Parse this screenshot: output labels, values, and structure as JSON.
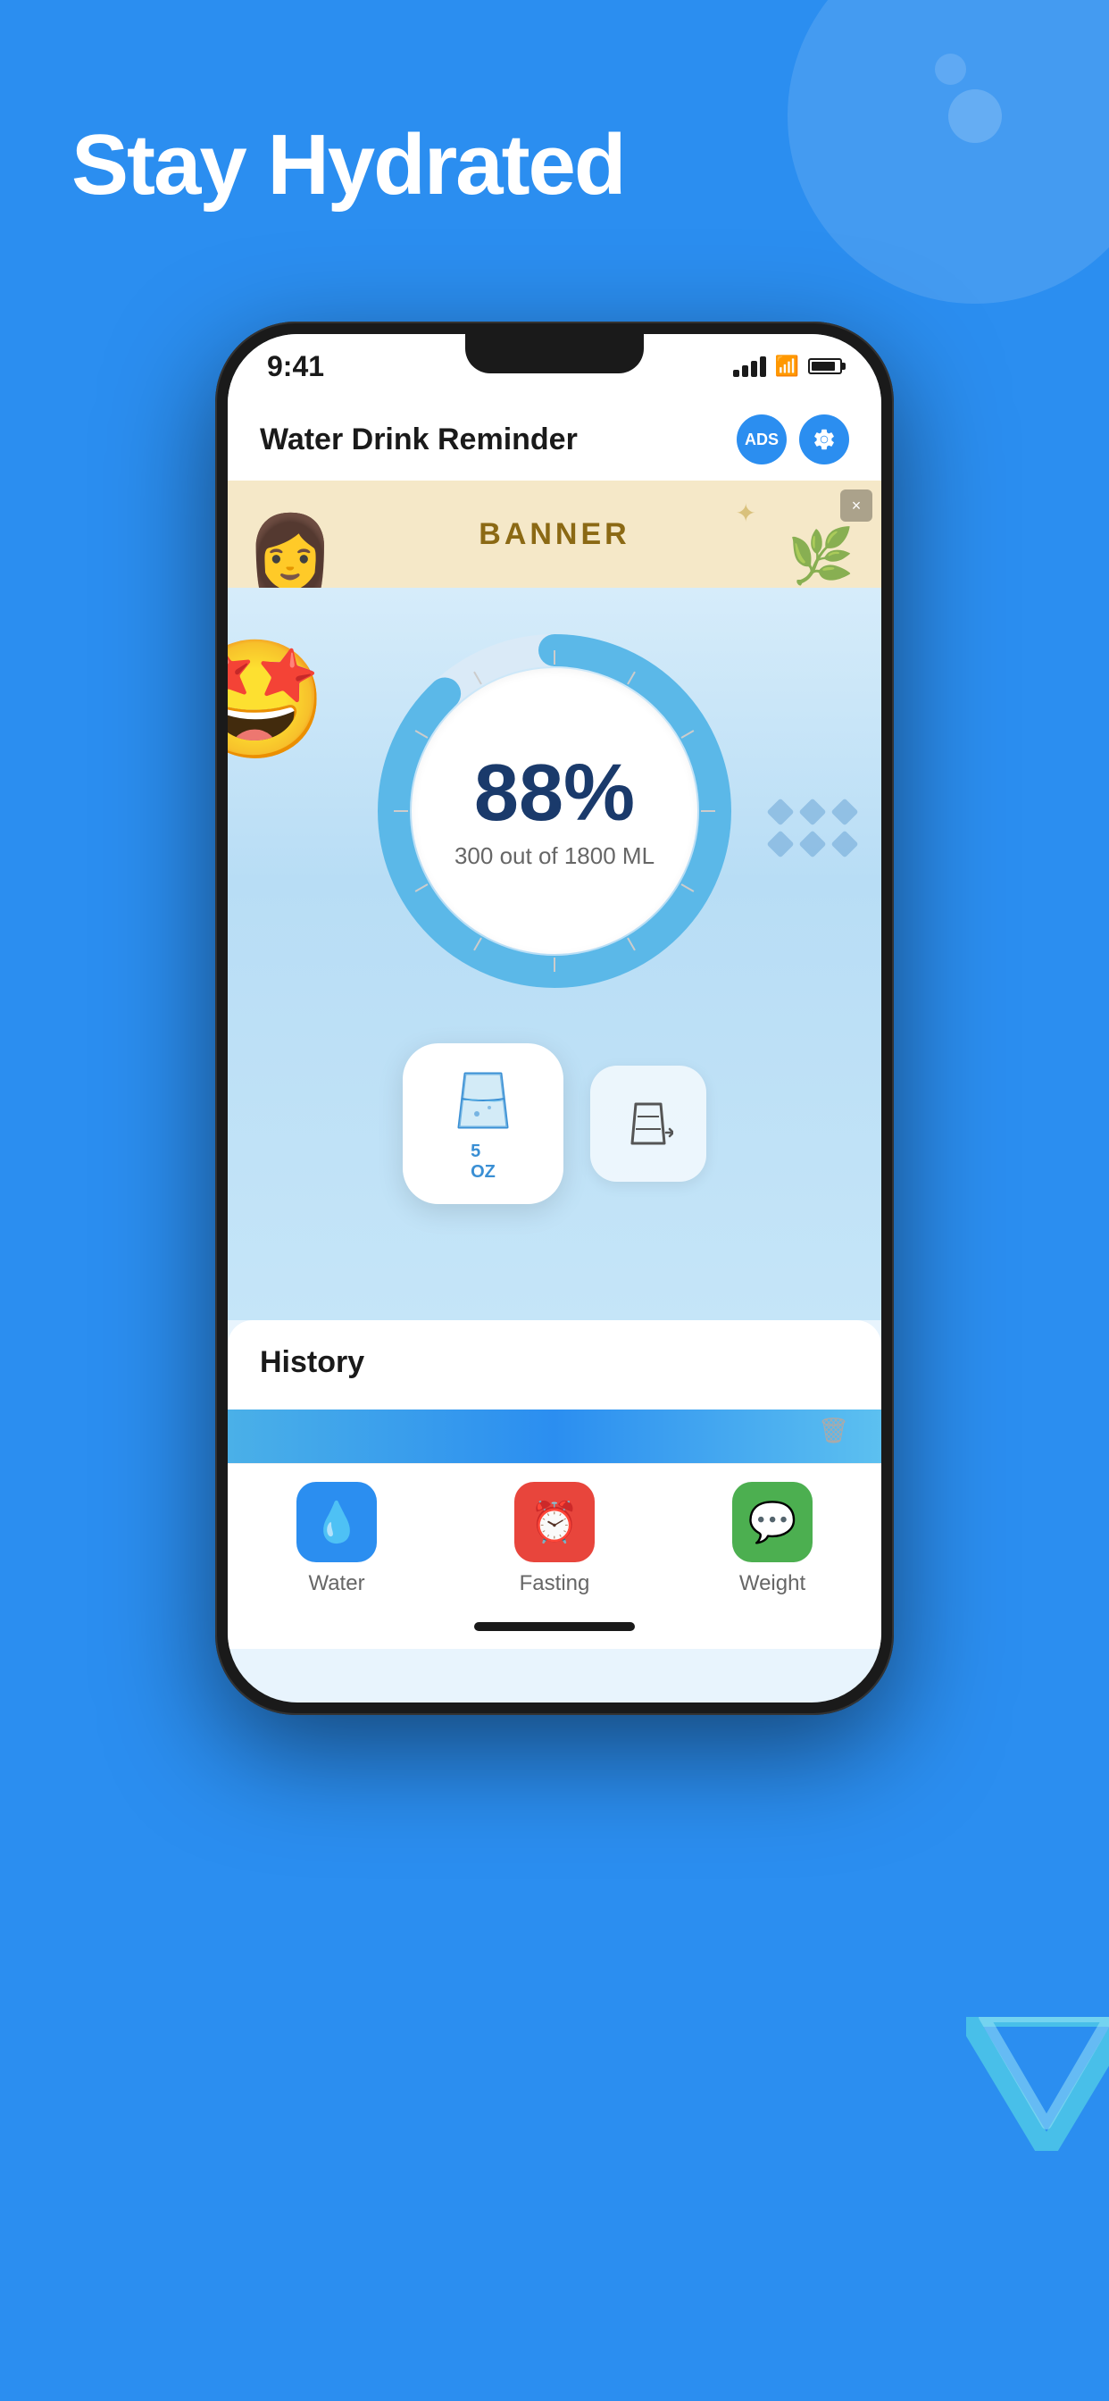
{
  "page": {
    "background_color": "#2B8EF0",
    "title": "Stay Hydrated"
  },
  "status_bar": {
    "time": "9:41",
    "signal_bars": 4,
    "wifi": true,
    "battery_percent": 85
  },
  "app_header": {
    "title": "Water Drink Reminder",
    "ads_label": "ADS",
    "settings_icon": "gear"
  },
  "banner": {
    "text": "BANNER",
    "close_label": "×"
  },
  "progress": {
    "percent": "88%",
    "current": 300,
    "total": 1800,
    "unit": "ML",
    "label": "300 out of 1800 ML",
    "ring_color": "#5bb8e8",
    "fill_degrees": 316
  },
  "mascot": {
    "emoji": "🤩"
  },
  "drink_buttons": {
    "primary": {
      "label": "5\nOZ",
      "icon": "water-glass"
    },
    "secondary": {
      "icon": "glass-list"
    }
  },
  "history": {
    "title": "History",
    "trash_icon": "trash"
  },
  "tab_bar": {
    "items": [
      {
        "label": "Water",
        "icon": "💧",
        "bg": "#2B8EF0",
        "active": true
      },
      {
        "label": "Fasting",
        "icon": "⏰",
        "bg": "#e8453c",
        "active": false
      },
      {
        "label": "Weight",
        "icon": "💬",
        "bg": "#4caf50",
        "active": false
      }
    ]
  }
}
